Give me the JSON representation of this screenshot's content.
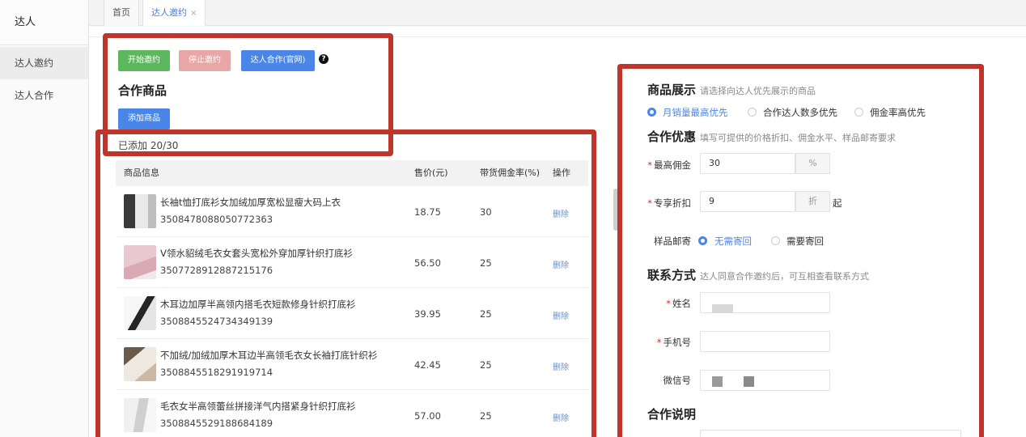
{
  "sidebar": {
    "header": "达人",
    "items": [
      {
        "label": "达人邀约"
      },
      {
        "label": "达人合作"
      }
    ]
  },
  "tabs": {
    "home": "首页",
    "current": "达人邀约",
    "close": "×"
  },
  "toolbar": {
    "start": "开始邀约",
    "stop": "停止邀约",
    "official": "达人合作(官网)",
    "help": "?"
  },
  "products": {
    "title": "合作商品",
    "add_button": "添加商品",
    "added_count": "已添加 20/30",
    "columns": {
      "info": "商品信息",
      "price": "售价(元)",
      "rate": "带货佣金率(%)",
      "action": "操作"
    },
    "rows": [
      {
        "name": "长袖t恤打底衫女加绒加厚宽松显瘦大码上衣",
        "id": "3508478088050772363",
        "price": "18.75",
        "rate": "30",
        "action": "删除"
      },
      {
        "name": "V领水貂绒毛衣女套头宽松外穿加厚针织打底衫",
        "id": "3507728912887215176",
        "price": "56.50",
        "rate": "25",
        "action": "删除"
      },
      {
        "name": "木耳边加厚半高领内搭毛衣短款修身针织打底衫",
        "id": "3508845524734349139",
        "price": "39.95",
        "rate": "25",
        "action": "删除"
      },
      {
        "name": "不加绒/加绒加厚木耳边半高领毛衣女长袖打底针织衫",
        "id": "3508845518291919714",
        "price": "42.45",
        "rate": "25",
        "action": "删除"
      },
      {
        "name": "毛衣女半高领蕾丝拼接洋气内搭紧身针织打底衫",
        "id": "3508845529188684189",
        "price": "57.00",
        "rate": "25",
        "action": "删除"
      }
    ]
  },
  "showcase": {
    "title": "商品展示",
    "hint": "请选择向达人优先展示的商品",
    "options": [
      "月销量最高优先",
      "合作达人数多优先",
      "佣金率高优先"
    ],
    "selected": "月销量最高优先"
  },
  "offer": {
    "title": "合作优惠",
    "hint": "填写可提供的价格折扣、佣金水平、样品邮寄要求",
    "commission_label": "最高佣金",
    "commission_value": "30",
    "commission_unit": "%",
    "discount_label": "专享折扣",
    "discount_value": "9",
    "discount_unit": "折",
    "discount_suffix": "起",
    "sample_label": "样品邮寄",
    "sample_options": [
      "无需寄回",
      "需要寄回"
    ],
    "sample_selected": "无需寄回"
  },
  "contact": {
    "title": "联系方式",
    "hint": "达人同意合作邀约后，可互相查看联系方式",
    "name_label": "姓名",
    "phone_label": "手机号",
    "wechat_label": "微信号"
  },
  "notes": {
    "title": "合作说明"
  },
  "required_mark": "*",
  "colors": {
    "primary": "#4a86e8",
    "success": "#5cb85c",
    "danger_light": "#e8a6a6",
    "annotation_red": "#c0352b"
  }
}
